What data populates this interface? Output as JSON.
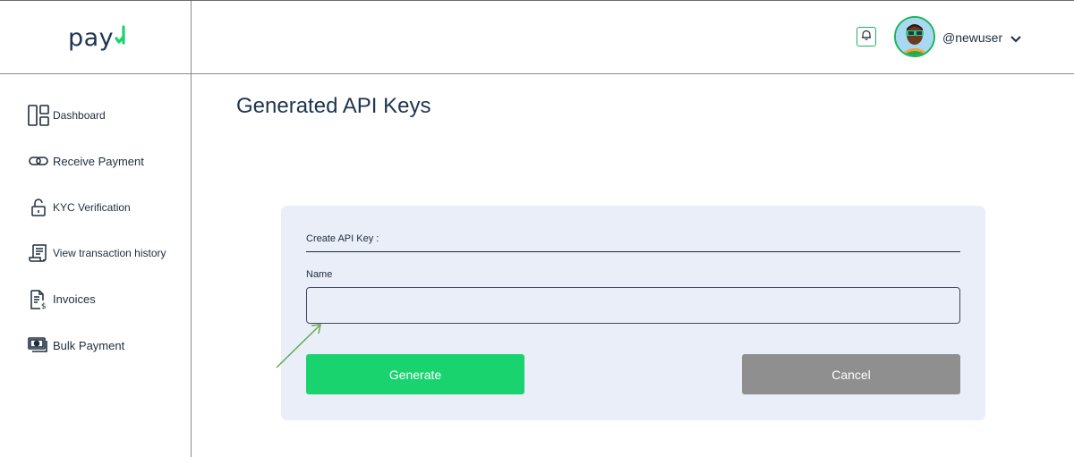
{
  "brand": {
    "logo_text": "pay",
    "accent": "#19d46e",
    "navy": "#1e3550"
  },
  "sidebar": {
    "items": [
      {
        "label": "Dashboard",
        "icon": "dashboard-icon"
      },
      {
        "label": "Receive Payment",
        "icon": "link-icon"
      },
      {
        "label": "KYC Verification",
        "icon": "lock-icon"
      },
      {
        "label": "View transaction history",
        "icon": "receipt-icon"
      },
      {
        "label": "Invoices",
        "icon": "invoice-icon"
      },
      {
        "label": "Bulk Payment",
        "icon": "cash-icon"
      }
    ]
  },
  "header": {
    "username": "@newuser",
    "notification_icon": "bell-icon",
    "menu_icon": "chevron-down-icon"
  },
  "page": {
    "title": "Generated API Keys"
  },
  "form": {
    "heading": "Create API Key :",
    "name_label": "Name",
    "name_value": "",
    "generate_label": "Generate",
    "cancel_label": "Cancel"
  }
}
